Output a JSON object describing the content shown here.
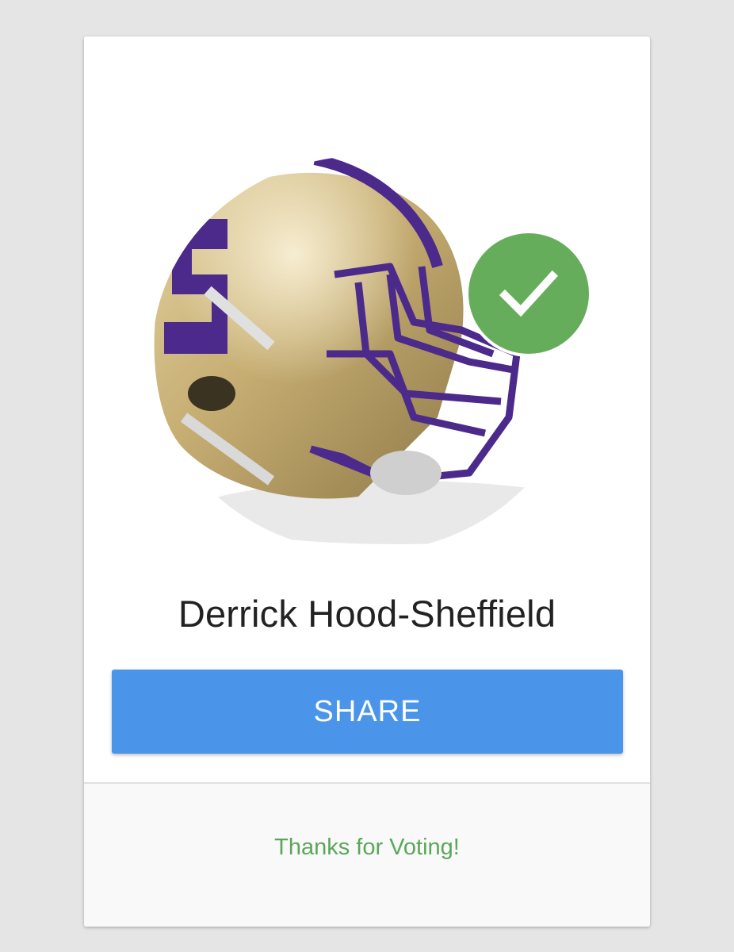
{
  "player": {
    "name": "Derrick Hood-Sheffield",
    "avatar_icon": "football-helmet-icon",
    "voted_icon": "checkmark-icon"
  },
  "actions": {
    "share_label": "SHARE"
  },
  "footer": {
    "status_text": "Thanks for Voting!"
  },
  "colors": {
    "page_background": "#e5e5e5",
    "share_button": "#4a94ea",
    "check_badge": "#66ad5b",
    "footer_text": "#5ba65a",
    "helmet_shell": "#c8b27a",
    "helmet_trim": "#4b2a8c"
  }
}
